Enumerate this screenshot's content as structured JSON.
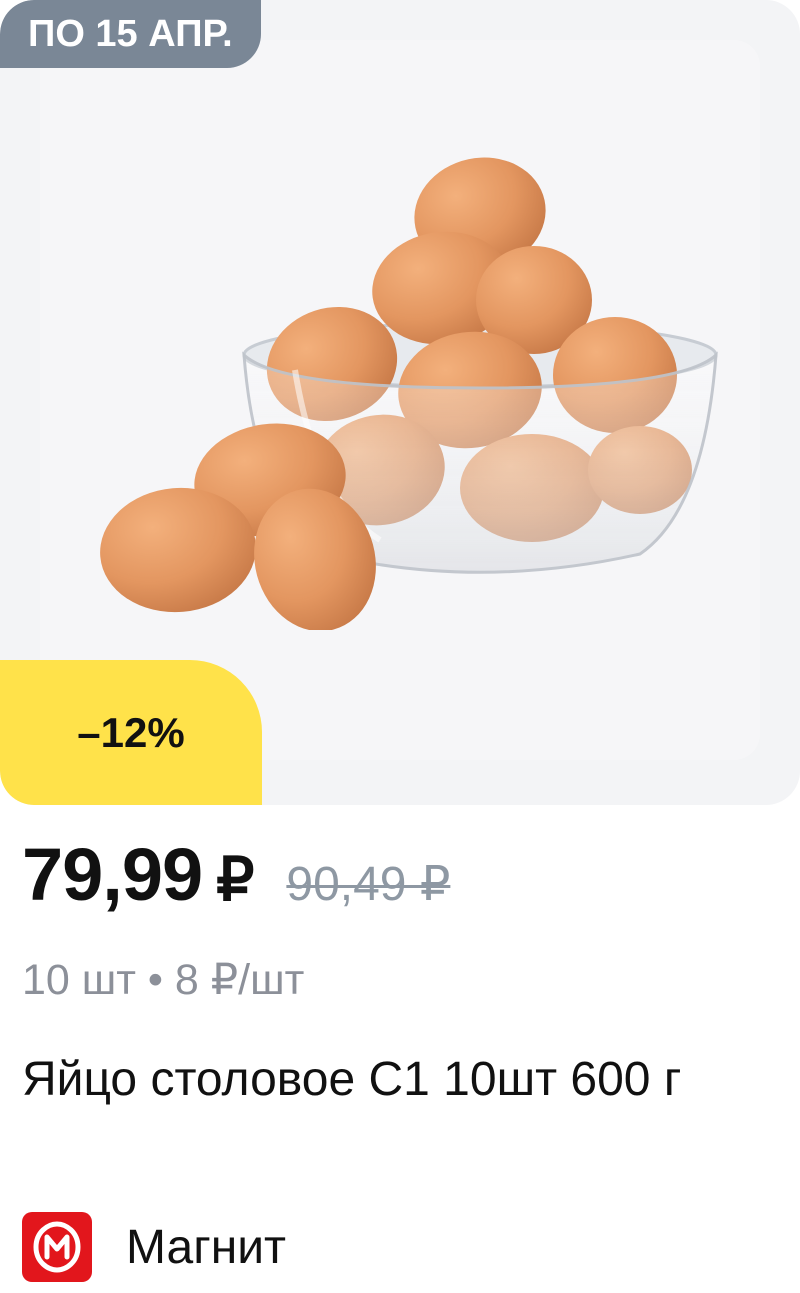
{
  "badges": {
    "date": "ПО 15 АПР.",
    "discount": "–12%"
  },
  "price": {
    "current": "79,99",
    "currency": "₽",
    "old": "90,49 ₽"
  },
  "unit_info": "10 шт • 8 ₽/шт",
  "product": {
    "title": "Яйцо столовое С1 10шт 600 г"
  },
  "store": {
    "name": "Магнит",
    "logo_icon": "magnit-logo-icon",
    "brand_color": "#e2161c"
  },
  "colors": {
    "discount_badge": "#ffe24a",
    "date_badge": "#7a8796",
    "image_background": "#f3f4f6",
    "secondary_text": "#8c9099"
  }
}
